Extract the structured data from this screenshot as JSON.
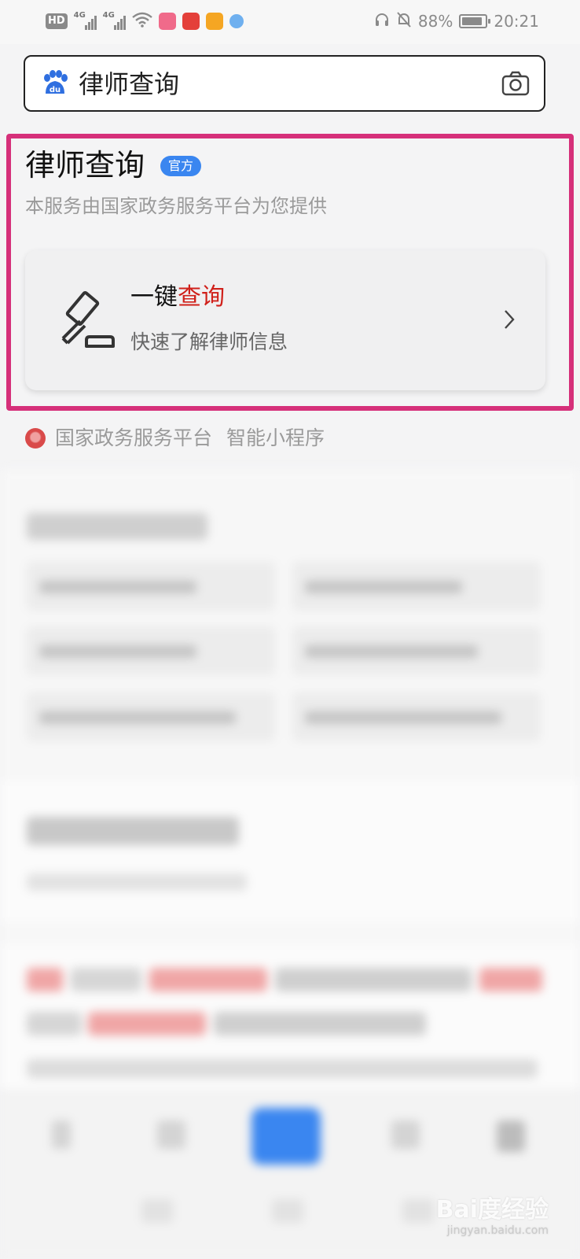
{
  "status_bar": {
    "hd": "HD",
    "network": "4G",
    "battery_percent": "88%",
    "battery_level": 0.88,
    "time": "20:21"
  },
  "search": {
    "query": "律师查询"
  },
  "card": {
    "title": "律师查询",
    "badge": "官方",
    "subtitle": "本服务由国家政务服务平台为您提供",
    "action_title_black": "一键",
    "action_title_red": "查询",
    "action_subtitle": "快速了解律师信息",
    "accent_color": "#d0201a",
    "badge_color": "#3a86f0",
    "highlight_color": "#d6307a"
  },
  "source": {
    "platform": "国家政务服务平台",
    "type": "智能小程序"
  },
  "watermark": {
    "brand": "Bai度经验",
    "url": "jingyan.baidu.com"
  }
}
